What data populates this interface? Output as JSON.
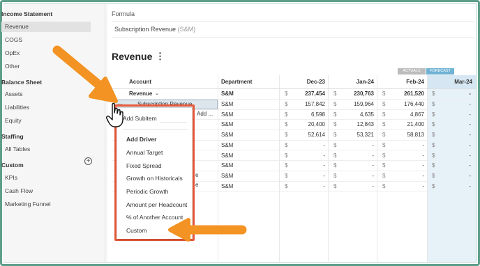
{
  "sidebar": {
    "sections": [
      {
        "title": "Income Statement",
        "items": [
          "Revenue",
          "COGS",
          "OpEx",
          "Other"
        ],
        "selected": "Revenue"
      },
      {
        "title": "Balance Sheet",
        "items": [
          "Assets",
          "Liabilities",
          "Equity"
        ]
      },
      {
        "title": "Staffing",
        "items": [
          "All Tables"
        ]
      },
      {
        "title": "Custom",
        "items": [
          "KPIs",
          "Cash Flow",
          "Marketing Funnel"
        ],
        "add_icon": "plus-circle-icon"
      }
    ]
  },
  "formula": {
    "label": "Formula",
    "value": "Subscription Revenue",
    "hint": "(S&M)"
  },
  "page": {
    "title": "Revenue",
    "menu_icon": "kebab-menu-icon"
  },
  "legend": {
    "actuals": "ACTUALS",
    "forecast": "FORECAST",
    "forecast_color": "#6fb2d4",
    "actuals_color": "#bcbcbc"
  },
  "table": {
    "headers": {
      "account": "Account",
      "department": "Department",
      "dec": "Dec-23",
      "jan": "Jan-24",
      "feb": "Feb-24",
      "mar": "Mar-24"
    },
    "revenue_row": {
      "account": "Revenue",
      "department": "S&M",
      "dec": "237,454",
      "jan": "230,763",
      "feb": "261,520",
      "mar": "-"
    },
    "selected_cell": "Subscription Revenue",
    "partial_label": "Add ...",
    "partial_e1": "e",
    "partial_e2": "e",
    "rows": [
      {
        "department": "S&M",
        "dec": "157,842",
        "jan": "159,964",
        "feb": "176,440",
        "mar": "-"
      },
      {
        "department": "S&M",
        "dec": "6,598",
        "jan": "4,635",
        "feb": "4,867",
        "mar": "-"
      },
      {
        "department": "S&M",
        "dec": "20,400",
        "jan": "12,843",
        "feb": "21,400",
        "mar": "-"
      },
      {
        "department": "S&M",
        "dec": "52,614",
        "jan": "53,321",
        "feb": "58,813",
        "mar": "-"
      },
      {
        "department": "S&M",
        "dec": "-",
        "jan": "-",
        "feb": "-",
        "mar": "-"
      },
      {
        "department": "S&M",
        "dec": "-",
        "jan": "-",
        "feb": "-",
        "mar": "-"
      },
      {
        "department": "S&M",
        "dec": "-",
        "jan": "-",
        "feb": "-",
        "mar": "-"
      },
      {
        "department": "S&M",
        "dec": "-",
        "jan": "-",
        "feb": "-",
        "mar": "-"
      },
      {
        "department": "S&M",
        "dec": "-",
        "jan": "-",
        "feb": "-",
        "mar": "-"
      }
    ],
    "currency": "$"
  },
  "dropdown": {
    "add_subitem": "Add Subitem",
    "add_driver_header": "Add Driver",
    "drivers": [
      "Annual Target",
      "Fixed Spread",
      "Growth on Historicals",
      "Periodic Growth",
      "Amount per Headcount",
      "% of Another Account",
      "Custom"
    ],
    "outline_color": "#ea5a3b"
  },
  "annotations": {
    "arrow_color": "#f39323",
    "cursor_icon": "hand-pointer-icon"
  }
}
